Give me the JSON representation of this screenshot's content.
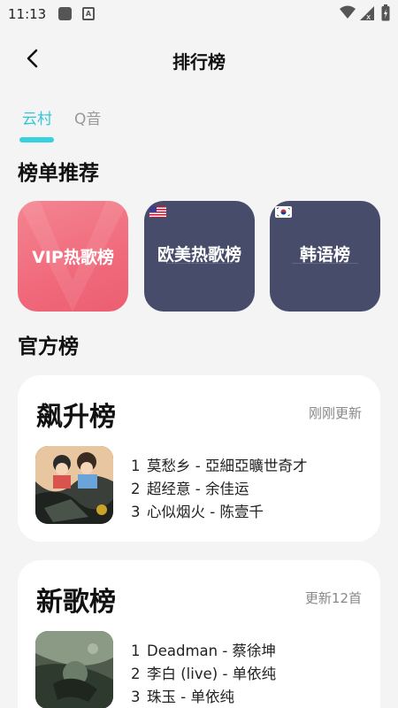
{
  "status_bar": {
    "time": "11:13",
    "app_icon_2": "A"
  },
  "header": {
    "title": "排行榜"
  },
  "tabs": [
    {
      "label": "云村",
      "active": true
    },
    {
      "label": "Q音",
      "active": false
    }
  ],
  "sections": {
    "recommend": "榜单推荐",
    "official": "官方榜"
  },
  "recommend_tiles": [
    {
      "label": "VIP热歌榜"
    },
    {
      "label": "欧美热歌榜"
    },
    {
      "label": "韩语榜"
    }
  ],
  "official_cards": [
    {
      "title": "飙升榜",
      "update": "刚刚更新",
      "songs": [
        {
          "rank": "1",
          "text": "莫愁乡 - 亞細亞曠世奇才"
        },
        {
          "rank": "2",
          "text": "超经意 - 余佳运"
        },
        {
          "rank": "3",
          "text": "心似烟火 - 陈壹千"
        }
      ]
    },
    {
      "title": "新歌榜",
      "update": "更新12首",
      "songs": [
        {
          "rank": "1",
          "text": "Deadman - 蔡徐坤"
        },
        {
          "rank": "2",
          "text": "李白 (live) - 单依纯"
        },
        {
          "rank": "3",
          "text": "珠玉 - 单依纯"
        }
      ]
    }
  ],
  "colors": {
    "accent": "#38d1df",
    "tile_dark": "#474c6b",
    "tile_vip": "#f06a7c"
  }
}
